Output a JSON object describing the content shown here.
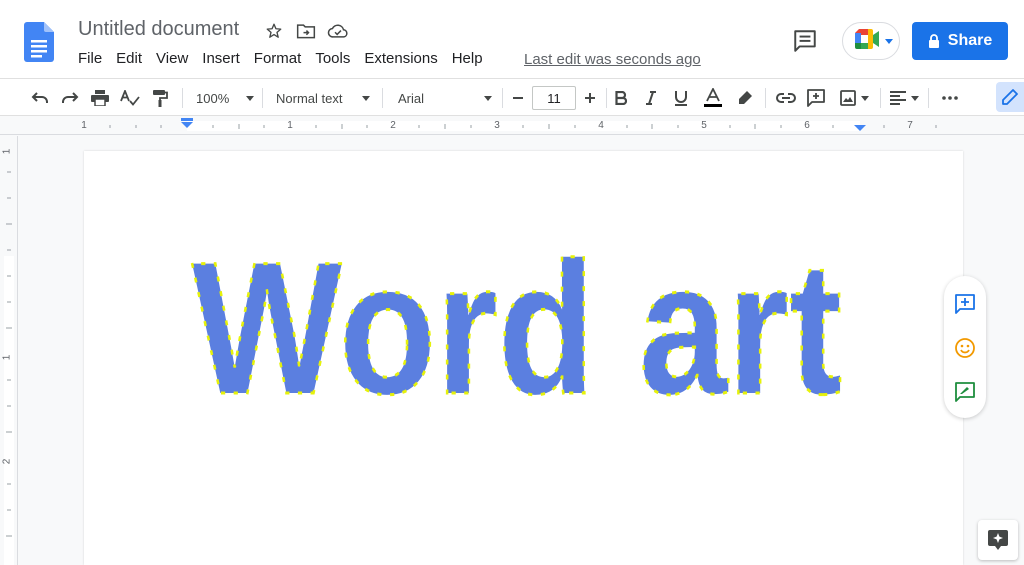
{
  "header": {
    "title": "Untitled document",
    "menu": [
      "File",
      "Edit",
      "View",
      "Insert",
      "Format",
      "Tools",
      "Extensions",
      "Help"
    ],
    "last_edit": "Last edit was seconds ago",
    "share_label": "Share"
  },
  "toolbar": {
    "zoom": "100%",
    "style": "Normal text",
    "font": "Arial",
    "font_size": "11"
  },
  "ruler": {
    "h_numbers": [
      "1",
      "1",
      "2",
      "3",
      "4",
      "5",
      "6",
      "7"
    ],
    "v_numbers": [
      "1",
      "1",
      "2"
    ]
  },
  "document": {
    "wordart_text": "Word art",
    "wordart_fill": "#5b7fe0",
    "wordart_handles": "#e6f20a"
  },
  "colors": {
    "accent": "#1a73e8",
    "icon": "#444746"
  }
}
